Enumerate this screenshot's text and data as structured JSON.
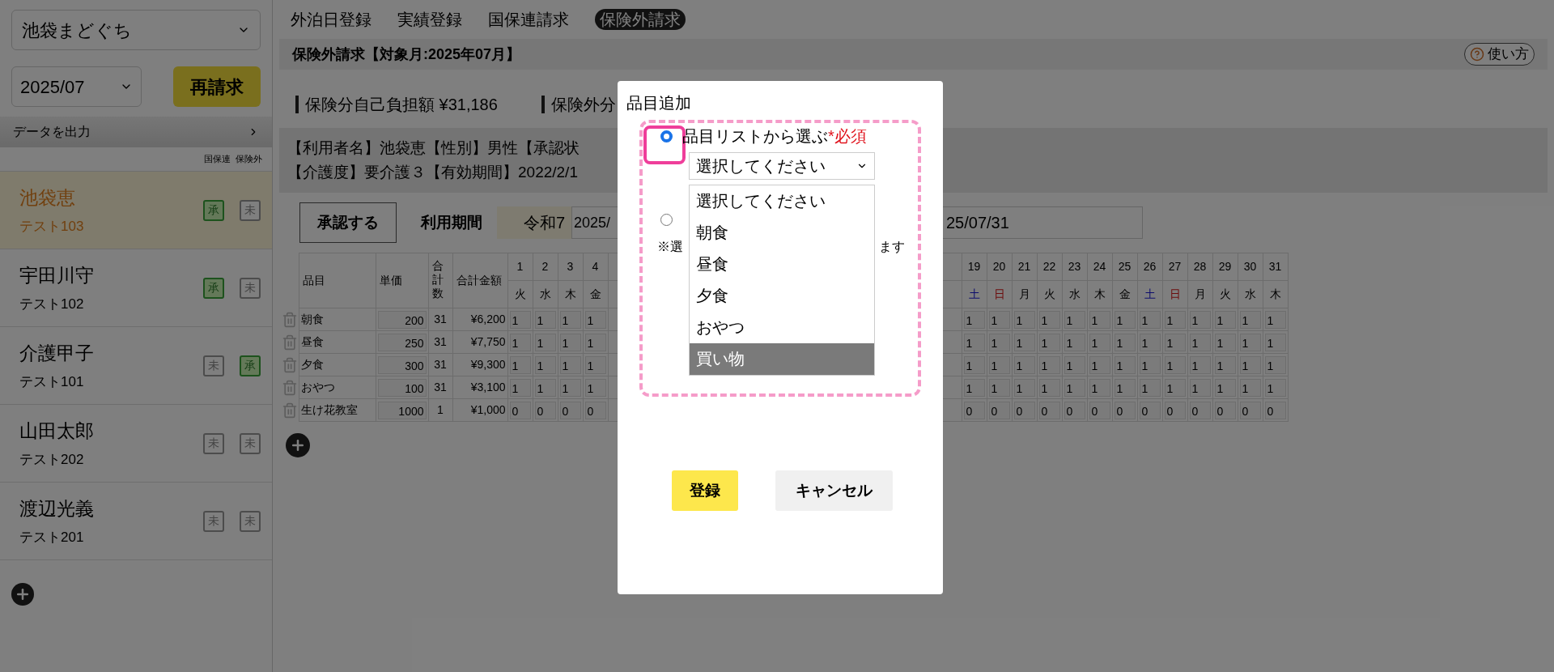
{
  "sidebar": {
    "facility_select": "池袋まどぐち",
    "month_select": "2025/07",
    "rebill_button": "再請求",
    "export_bar": "データを出力",
    "status_columns": [
      "国保連",
      "保険外"
    ],
    "users": [
      {
        "name": "池袋恵",
        "code": "テスト103",
        "selected": true,
        "statuses": [
          {
            "label": "承",
            "approved": true
          },
          {
            "label": "未",
            "approved": false
          }
        ]
      },
      {
        "name": "宇田川守",
        "code": "テスト102",
        "selected": false,
        "statuses": [
          {
            "label": "承",
            "approved": true
          },
          {
            "label": "未",
            "approved": false
          }
        ]
      },
      {
        "name": "介護甲子",
        "code": "テスト101",
        "selected": false,
        "statuses": [
          {
            "label": "未",
            "approved": false
          },
          {
            "label": "承",
            "approved": true
          }
        ]
      },
      {
        "name": "山田太郎",
        "code": "テスト202",
        "selected": false,
        "statuses": [
          {
            "label": "未",
            "approved": false
          },
          {
            "label": "未",
            "approved": false
          }
        ]
      },
      {
        "name": "渡辺光義",
        "code": "テスト201",
        "selected": false,
        "statuses": [
          {
            "label": "未",
            "approved": false
          },
          {
            "label": "未",
            "approved": false
          }
        ]
      }
    ]
  },
  "tabs": [
    {
      "label": "外泊日登録",
      "selected": false
    },
    {
      "label": "実績登録",
      "selected": false
    },
    {
      "label": "国保連請求",
      "selected": false
    },
    {
      "label": "保険外請求",
      "selected": true
    }
  ],
  "header": {
    "title": "保険外請求【対象月:2025年07月】",
    "help_button": "使い方"
  },
  "summary": [
    "保険分自己負担額 ¥31,186",
    "保険外分"
  ],
  "user_info": [
    "【利用者名】池袋恵【性別】男性【承認状",
    "【介護度】要介護３【有効期間】2022/2/1"
  ],
  "approve_button": "承認する",
  "period": {
    "label": "利用期間",
    "era": "令和7",
    "start": "2025/",
    "end": "25/07/31"
  },
  "table": {
    "columns": [
      "品目",
      "単価",
      "合計数",
      "合計金額"
    ],
    "days_before": [
      {
        "day": "1",
        "weekday": "火",
        "kind": "weekday"
      },
      {
        "day": "2",
        "weekday": "水",
        "kind": "weekday"
      },
      {
        "day": "3",
        "weekday": "木",
        "kind": "weekday"
      },
      {
        "day": "4",
        "weekday": "金",
        "kind": "weekday"
      }
    ],
    "days_after": [
      {
        "day": "19",
        "weekday": "土",
        "kind": "saturday"
      },
      {
        "day": "20",
        "weekday": "日",
        "kind": "sunday"
      },
      {
        "day": "21",
        "weekday": "月",
        "kind": "weekday"
      },
      {
        "day": "22",
        "weekday": "火",
        "kind": "weekday"
      },
      {
        "day": "23",
        "weekday": "水",
        "kind": "weekday"
      },
      {
        "day": "24",
        "weekday": "木",
        "kind": "weekday"
      },
      {
        "day": "25",
        "weekday": "金",
        "kind": "weekday"
      },
      {
        "day": "26",
        "weekday": "土",
        "kind": "saturday"
      },
      {
        "day": "27",
        "weekday": "日",
        "kind": "sunday"
      },
      {
        "day": "28",
        "weekday": "月",
        "kind": "weekday"
      },
      {
        "day": "29",
        "weekday": "火",
        "kind": "weekday"
      },
      {
        "day": "30",
        "weekday": "水",
        "kind": "weekday"
      },
      {
        "day": "31",
        "weekday": "木",
        "kind": "weekday"
      }
    ],
    "rows": [
      {
        "item": "朝食",
        "price": "200",
        "count": "31",
        "amount": "¥6,200",
        "values_before": [
          "1",
          "1",
          "1",
          "1"
        ],
        "values_after": [
          "1",
          "1",
          "1",
          "1",
          "1",
          "1",
          "1",
          "1",
          "1",
          "1",
          "1",
          "1",
          "1"
        ]
      },
      {
        "item": "昼食",
        "price": "250",
        "count": "31",
        "amount": "¥7,750",
        "values_before": [
          "1",
          "1",
          "1",
          "1"
        ],
        "values_after": [
          "1",
          "1",
          "1",
          "1",
          "1",
          "1",
          "1",
          "1",
          "1",
          "1",
          "1",
          "1",
          "1"
        ]
      },
      {
        "item": "夕食",
        "price": "300",
        "count": "31",
        "amount": "¥9,300",
        "values_before": [
          "1",
          "1",
          "1",
          "1"
        ],
        "values_after": [
          "1",
          "1",
          "1",
          "1",
          "1",
          "1",
          "1",
          "1",
          "1",
          "1",
          "1",
          "1",
          "1"
        ]
      },
      {
        "item": "おやつ",
        "price": "100",
        "count": "31",
        "amount": "¥3,100",
        "values_before": [
          "1",
          "1",
          "1",
          "1"
        ],
        "values_after": [
          "1",
          "1",
          "1",
          "1",
          "1",
          "1",
          "1",
          "1",
          "1",
          "1",
          "1",
          "1",
          "1"
        ]
      },
      {
        "item": "生け花教室",
        "price": "1000",
        "count": "1",
        "amount": "¥1,000",
        "values_before": [
          "0",
          "0",
          "0",
          "0"
        ],
        "values_after": [
          "0",
          "0",
          "0",
          "0",
          "0",
          "0",
          "0",
          "0",
          "0",
          "0",
          "0",
          "0",
          "0"
        ]
      }
    ]
  },
  "modal": {
    "title": "品目追加",
    "list_option": {
      "selected": true,
      "label": "品目リストから選ぶ",
      "required": "*必須",
      "select_value": "選択してください",
      "options": [
        {
          "label": "選択してください",
          "selected": false
        },
        {
          "label": "朝食",
          "selected": false
        },
        {
          "label": "昼食",
          "selected": false
        },
        {
          "label": "夕食",
          "selected": false
        },
        {
          "label": "おやつ",
          "selected": false
        },
        {
          "label": "買い物",
          "selected": true
        }
      ]
    },
    "manual_option": {
      "selected": false
    },
    "note_start": "※選",
    "note_end": "ます",
    "buttons": [
      {
        "label": "登録",
        "kind": "primary"
      },
      {
        "label": "キャンセル",
        "kind": "secondary"
      }
    ]
  }
}
